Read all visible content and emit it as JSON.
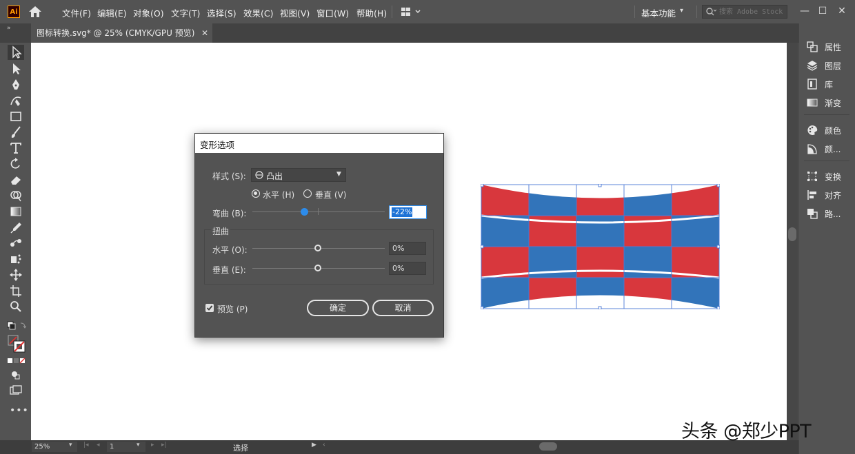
{
  "app": {
    "logo": "Ai"
  },
  "menu": [
    "文件(F)",
    "编辑(E)",
    "对象(O)",
    "文字(T)",
    "选择(S)",
    "效果(C)",
    "视图(V)",
    "窗口(W)",
    "帮助(H)"
  ],
  "workspace": "基本功能",
  "stock_search_placeholder": "搜索 Adobe Stock",
  "document_tab": "图标转换.svg* @ 25% (CMYK/GPU 预览)",
  "right_panel": {
    "group1": [
      "属性",
      "图层",
      "库",
      "渐变"
    ],
    "group2": [
      "颜色",
      "颜..."
    ],
    "group3": [
      "变换",
      "对齐",
      "路..."
    ]
  },
  "status": {
    "zoom": "25%",
    "page": "1",
    "tool": "选择"
  },
  "dialog": {
    "title": "变形选项",
    "style_label": "样式 (S):",
    "style_value": "凸出",
    "horizontal_label": "水平 (H)",
    "vertical_label": "垂直 (V)",
    "orientation": "水平",
    "bend_label": "弯曲 (B):",
    "bend_value": "-22%",
    "distortion_label": "扭曲",
    "dist_horizontal_label": "水平 (O):",
    "dist_horizontal_value": "0%",
    "dist_vertical_label": "垂直 (E):",
    "dist_vertical_value": "0%",
    "preview_label": "预览 (P)",
    "preview_checked": true,
    "ok_label": "确定",
    "cancel_label": "取消"
  },
  "watermark": "头条 @郑少PPT",
  "colors": {
    "red": "#d8373d",
    "blue": "#3274ba",
    "selection": "#4a78d6",
    "slider_blue": "#2d8ceb"
  }
}
